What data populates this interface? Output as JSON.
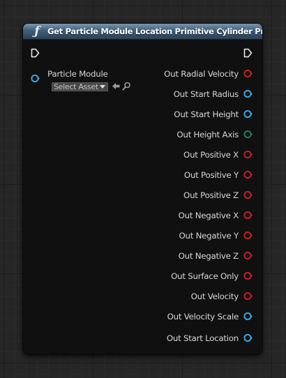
{
  "node": {
    "title": "Get Particle Module Location Primitive Cylinder Props",
    "icon": "function-icon",
    "header_color": "#3f5f7a"
  },
  "input": {
    "label": "Particle Module",
    "asset_select_label": "Select Asset",
    "pin_color": "#3aa3e0"
  },
  "outputs": [
    {
      "label": "Out Radial Velocity",
      "type": "bool",
      "color": "#c32020"
    },
    {
      "label": "Out Start Radius",
      "type": "float",
      "color": "#3aa3e0"
    },
    {
      "label": "Out Start Height",
      "type": "float",
      "color": "#3aa3e0"
    },
    {
      "label": "Out Height Axis",
      "type": "enum",
      "color": "#1b7d5d"
    },
    {
      "label": "Out Positive X",
      "type": "bool",
      "color": "#c32020"
    },
    {
      "label": "Out Positive Y",
      "type": "bool",
      "color": "#c32020"
    },
    {
      "label": "Out Positive Z",
      "type": "bool",
      "color": "#c32020"
    },
    {
      "label": "Out Negative X",
      "type": "bool",
      "color": "#c32020"
    },
    {
      "label": "Out Negative Y",
      "type": "bool",
      "color": "#c32020"
    },
    {
      "label": "Out Negative Z",
      "type": "bool",
      "color": "#c32020"
    },
    {
      "label": "Out Surface Only",
      "type": "bool",
      "color": "#c32020"
    },
    {
      "label": "Out Velocity",
      "type": "bool",
      "color": "#c32020"
    },
    {
      "label": "Out Velocity Scale",
      "type": "float",
      "color": "#3aa3e0"
    },
    {
      "label": "Out Start Location",
      "type": "float",
      "color": "#3aa3e0"
    }
  ]
}
